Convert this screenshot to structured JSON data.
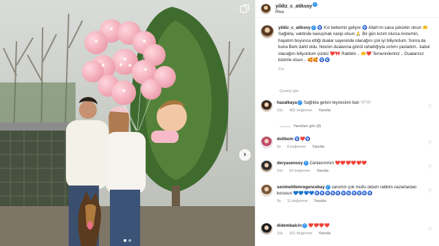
{
  "post": {
    "username": "yildiz_c_atiksoy",
    "location": "Riva"
  },
  "caption": {
    "username": "yildiz_c_atiksoy",
    "text": "🧿 Kız bebemiz geliyor 🧿 Allah'ım sana şükürler olsun 🤲 Sağlıkla, vaktinde kavuşmak nasip olsun 🙏 Bir gün kızım olursa Annemin, hayatım boyunca ettiği dualar sayesinde olacağını çok iyi biliyordum. Sonra da buna Berk dahil oldu. İkisinin dualarına gönül rahatlığıyla sırtımı yasladım.. kabul olacağını biliyordum çünkü ❤️🎀 Rabbim .. 🤲❤️ Temennileriniz .. Dualarınız bizimle olsun .. 🥰🥰 🧿🧿",
    "time": "11s"
  },
  "translate_label": "Çeviriyi gör",
  "comments": [
    {
      "username": "hazalkaya",
      "text": "Sağlıkla gelsin teyzesinin balı 🤍🤍",
      "time": "10s",
      "likes": "482 beğenme",
      "reply": "Yanıtla"
    },
    {
      "username": "dolibom",
      "text": "🧿❤️🧿",
      "time": "6s",
      "likes": "8 beğenme",
      "reply": "Yanıtla"
    },
    {
      "username": "deryasensoy",
      "text": "Canlarımmm ❤️❤️❤️❤️❤️❤️",
      "time": "10s",
      "likes": "59 beğenme",
      "reply": "Yanıtla"
    },
    {
      "username": "sevimelifemregencebay",
      "text": "canımm çok mutlu oldum rabbim nazarlardan korusun 💙💙💙💙🧿🧿🧿🧿🧿🧿🧿🧿🧿🧿🧿",
      "time": "9s",
      "likes": "11 beğenme",
      "reply": "Yanıtla"
    },
    {
      "username": "didembalcin",
      "text": "❤️❤️❤️❤️",
      "time": "10s",
      "likes": "161 beğenme",
      "reply": "Yanıtla"
    }
  ],
  "replies_toggle": "Yanıtları gör (4)",
  "icons": {
    "like": "heart-outline-icon",
    "verified": "verified-badge-icon",
    "multi_photo": "carousel-icon",
    "next": "chevron-right-icon"
  },
  "colors": {
    "verified": "#3897f0",
    "muted": "#8e8e8e",
    "text": "#262626"
  }
}
